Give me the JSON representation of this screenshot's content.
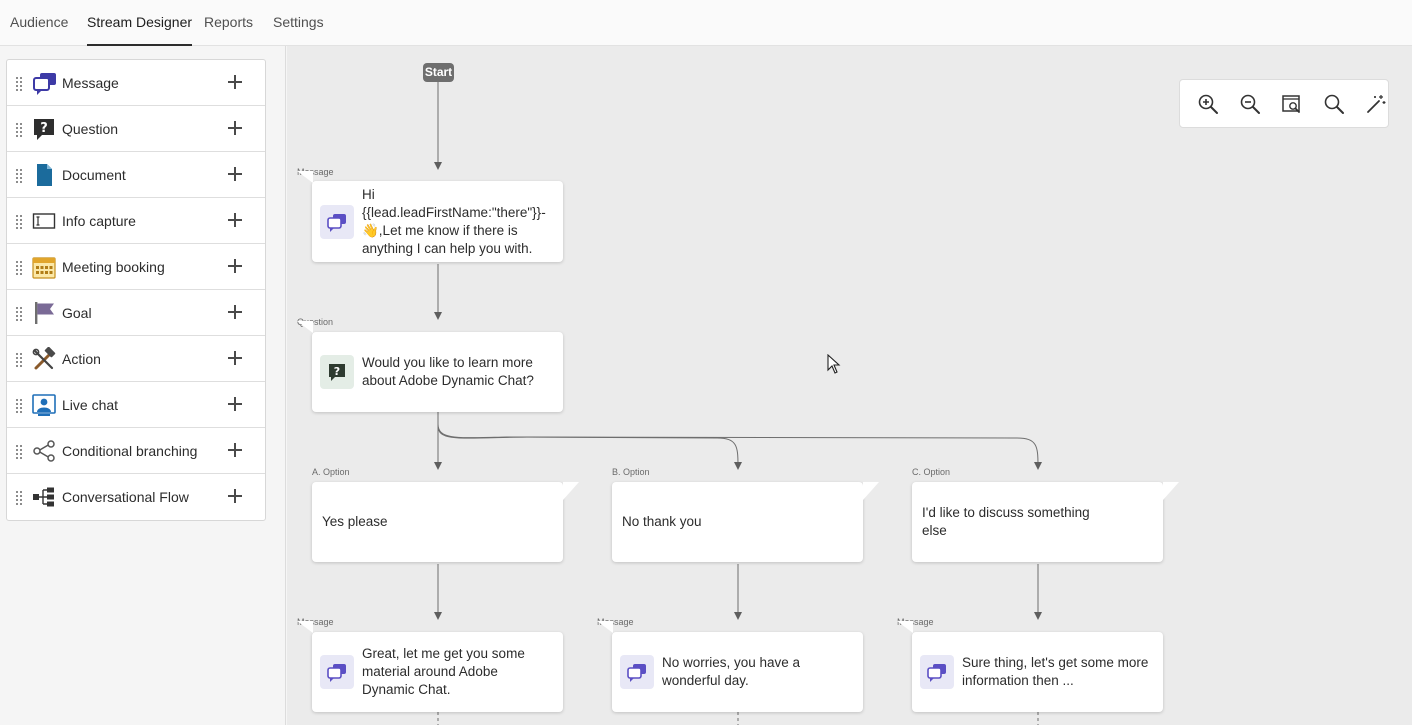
{
  "tabs": [
    {
      "label": "Audience"
    },
    {
      "label": "Stream Designer"
    },
    {
      "label": "Reports"
    },
    {
      "label": "Settings"
    }
  ],
  "palette": {
    "items": [
      {
        "label": "Message",
        "icon": "message-icon"
      },
      {
        "label": "Question",
        "icon": "question-icon"
      },
      {
        "label": "Document",
        "icon": "document-icon"
      },
      {
        "label": "Info capture",
        "icon": "info-capture-icon"
      },
      {
        "label": "Meeting booking",
        "icon": "calendar-icon"
      },
      {
        "label": "Goal",
        "icon": "flag-icon"
      },
      {
        "label": "Action",
        "icon": "hammer-wrench-icon"
      },
      {
        "label": "Live chat",
        "icon": "live-chat-icon"
      },
      {
        "label": "Conditional branching",
        "icon": "branch-icon"
      },
      {
        "label": "Conversational Flow",
        "icon": "flow-icon"
      }
    ]
  },
  "canvas": {
    "start_label": "Start",
    "message1": {
      "tag": "Message",
      "lines": [
        "Hi",
        "{{lead.leadFirstName:\"there\"}}-",
        "👋,Let me know if there is",
        "anything I can help you with."
      ]
    },
    "question1": {
      "tag": "Question",
      "lines": [
        "Would you like to learn more",
        "about Adobe Dynamic Chat?"
      ]
    },
    "options": [
      {
        "tag": "A. Option",
        "lines": [
          "Yes please"
        ]
      },
      {
        "tag": "B. Option",
        "lines": [
          "No thank you"
        ]
      },
      {
        "tag": "C. Option",
        "lines": [
          "I'd like to discuss something",
          "else"
        ]
      }
    ],
    "replies": [
      {
        "tag": "Message",
        "lines": [
          "Great, let me get you some",
          "material around Adobe",
          "Dynamic Chat."
        ]
      },
      {
        "tag": "Message",
        "lines": [
          "No worries, you have a",
          "wonderful day."
        ]
      },
      {
        "tag": "Message",
        "lines": [
          "Sure thing, let's get some more",
          "information then ..."
        ]
      }
    ]
  },
  "zoom_toolbar": {
    "buttons": [
      "zoom-in-icon",
      "zoom-out-icon",
      "fit-to-screen-icon",
      "search-icon",
      "magic-wand-icon"
    ]
  },
  "colors": {
    "accent_purple": "#5b4fc4",
    "canvas_bg": "#ebebeb",
    "start_badge": "#6e6e6e"
  }
}
